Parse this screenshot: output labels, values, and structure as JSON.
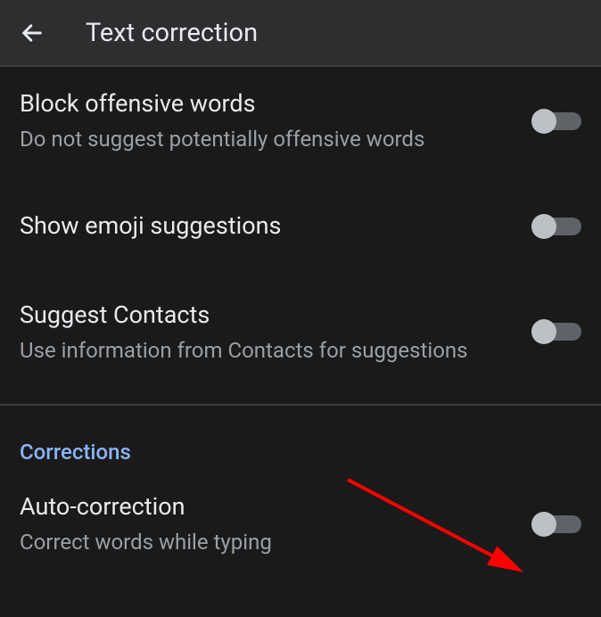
{
  "header": {
    "title": "Text correction"
  },
  "settings": {
    "block_offensive": {
      "title": "Block offensive words",
      "subtitle": "Do not suggest potentially offensive words",
      "enabled": false
    },
    "emoji_suggestions": {
      "title": "Show emoji suggestions",
      "enabled": false
    },
    "suggest_contacts": {
      "title": "Suggest Contacts",
      "subtitle": "Use information from Contacts for suggestions",
      "enabled": false
    },
    "auto_correction": {
      "title": "Auto-correction",
      "subtitle": "Correct words while typing",
      "enabled": false
    }
  },
  "sections": {
    "corrections": "Corrections"
  }
}
